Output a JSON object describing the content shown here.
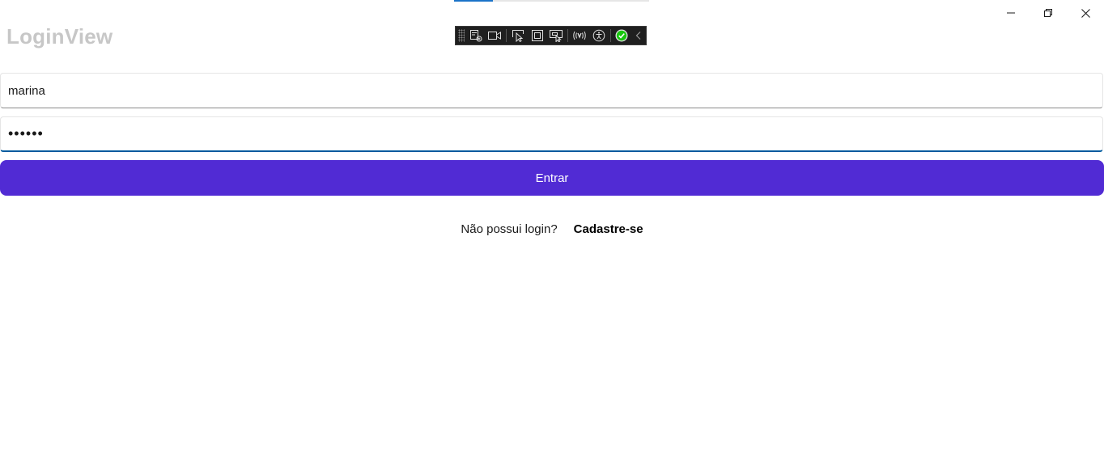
{
  "window": {
    "title": "LoginView",
    "progress": 0.2
  },
  "caption_buttons": {
    "minimize_icon": "minimize-icon",
    "maximize_icon": "restore-icon",
    "close_icon": "close-icon"
  },
  "debug_toolbar": {
    "items": [
      "select-element-icon",
      "record-icon",
      "pointer-icon",
      "display-layout-icon",
      "track-focus-icon",
      "hot-reload-icon",
      "accessibility-icon",
      "check-status-icon",
      "collapse-icon"
    ],
    "status_color": "#16c60c"
  },
  "form": {
    "username_value": "marina",
    "password_value": "••••••",
    "login_button_label": "Entrar",
    "signup_prompt": "Não possui login?",
    "signup_link": "Cadastre-se"
  },
  "colors": {
    "accent": "#512bd4",
    "focus_border": "#005a9e",
    "title": "#c7c7c7"
  }
}
